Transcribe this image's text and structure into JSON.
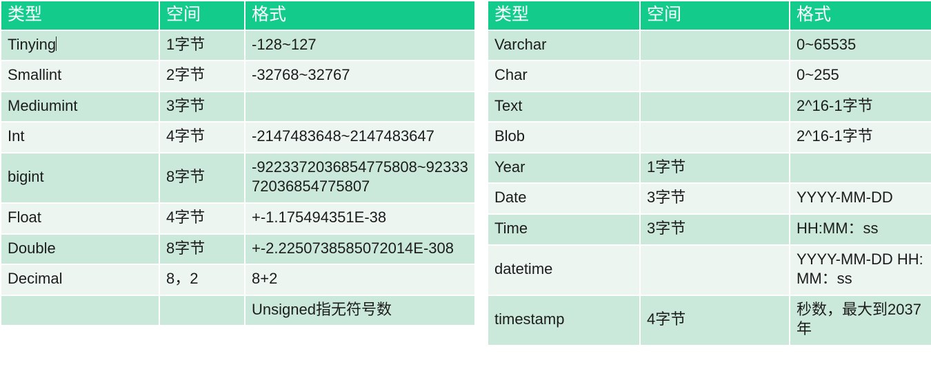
{
  "theme": {
    "header_green": "#13CC8C",
    "row_shade_dark": "#cbe9da",
    "row_shade_light": "#ecf5f0",
    "page_background": "#ffffff",
    "header_text": "#ffffff",
    "body_text": "#1c1c1c"
  },
  "tables": [
    {
      "id": "numeric-types-table",
      "columns": [
        "类型",
        "空间",
        "格式"
      ],
      "rows": [
        {
          "type": "Tinying",
          "space": "1字节",
          "format": "-128~127"
        },
        {
          "type": "Smallint",
          "space": "2字节",
          "format": "-32768~32767"
        },
        {
          "type": "Mediumint",
          "space": "3字节",
          "format": ""
        },
        {
          "type": "Int",
          "space": "4字节",
          "format": "-2147483648~2147483647"
        },
        {
          "type": "bigint",
          "space": "8字节",
          "format": "-9223372036854775808~9233372036854775807"
        },
        {
          "type": "Float",
          "space": "4字节",
          "format": "+-1.175494351E-38"
        },
        {
          "type": "Double",
          "space": "8字节",
          "format": "+-2.2250738585072014E-308"
        },
        {
          "type": "Decimal",
          "space": "8，2",
          "format": "8+2"
        },
        {
          "type": "",
          "space": "",
          "format": "Unsigned指无符号数"
        }
      ]
    },
    {
      "id": "string-and-date-types-table",
      "columns": [
        "类型",
        "空间",
        "格式"
      ],
      "rows": [
        {
          "type": "Varchar",
          "space": "",
          "format": "0~65535"
        },
        {
          "type": "Char",
          "space": "",
          "format": "0~255"
        },
        {
          "type": "Text",
          "space": "",
          "format": "2^16-1字节"
        },
        {
          "type": "Blob",
          "space": "",
          "format": "2^16-1字节"
        },
        {
          "type": "Year",
          "space": "1字节",
          "format": ""
        },
        {
          "type": "Date",
          "space": "3字节",
          "format": "YYYY-MM-DD"
        },
        {
          "type": "Time",
          "space": "3字节",
          "format": "HH:MM：ss"
        },
        {
          "type": "datetime",
          "space": "",
          "format": "YYYY-MM-DD HH:MM：ss"
        },
        {
          "type": "timestamp",
          "space": "4字节",
          "format": "秒数，最大到2037年"
        }
      ]
    }
  ]
}
